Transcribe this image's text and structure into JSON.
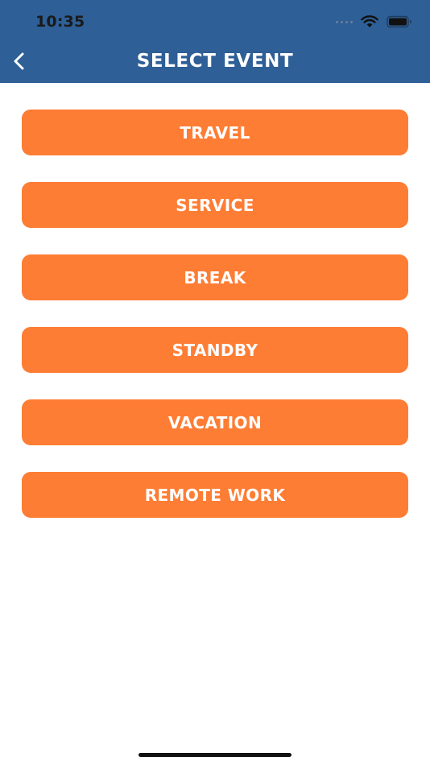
{
  "status_bar": {
    "time": "10:35"
  },
  "nav": {
    "title": "SELECT EVENT",
    "back_icon": "chevron-left-icon"
  },
  "events": [
    {
      "label": "TRAVEL"
    },
    {
      "label": "SERVICE"
    },
    {
      "label": "BREAK"
    },
    {
      "label": "STANDBY"
    },
    {
      "label": "VACATION"
    },
    {
      "label": "REMOTE WORK"
    }
  ],
  "colors": {
    "header_bg": "#2e5f96",
    "button_bg": "#fe7d34",
    "button_text": "#ffffff"
  }
}
